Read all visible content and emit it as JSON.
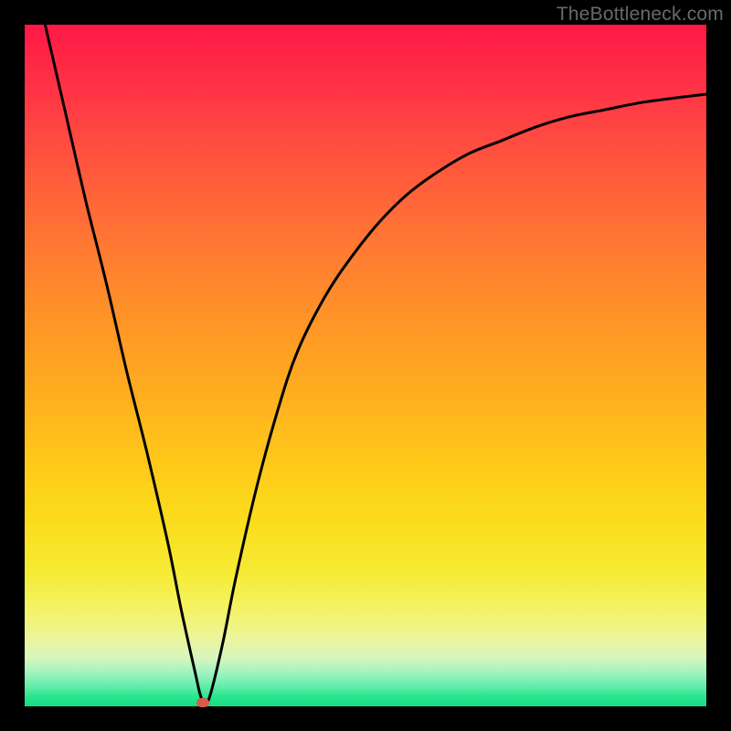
{
  "watermark": "TheBottleneck.com",
  "chart_data": {
    "type": "line",
    "title": "",
    "xlabel": "",
    "ylabel": "",
    "xlim": [
      0,
      100
    ],
    "ylim": [
      0,
      100
    ],
    "grid": false,
    "x": [
      3,
      6,
      9,
      12,
      15,
      18,
      21,
      23,
      25,
      26,
      27,
      29,
      31,
      34,
      37,
      40,
      44,
      48,
      52,
      56,
      60,
      65,
      70,
      75,
      80,
      85,
      90,
      95,
      100
    ],
    "y": [
      100,
      87,
      74,
      62,
      49,
      37,
      24,
      14,
      5,
      1,
      1,
      9,
      19,
      32,
      43,
      52,
      60,
      66,
      71,
      75,
      78,
      81,
      83,
      85,
      86.5,
      87.5,
      88.5,
      89.2,
      89.8
    ],
    "marker": {
      "x": 26.2,
      "y": 0.6,
      "color": "#d95a4a"
    },
    "background": {
      "type": "vertical-gradient",
      "stops": [
        {
          "pct": 0,
          "color": "#ff1846"
        },
        {
          "pct": 50,
          "color": "#ffa81f"
        },
        {
          "pct": 82,
          "color": "#f5f050"
        },
        {
          "pct": 100,
          "color": "#10df82"
        }
      ]
    },
    "line_style": {
      "color": "#000000",
      "width": 3
    }
  }
}
